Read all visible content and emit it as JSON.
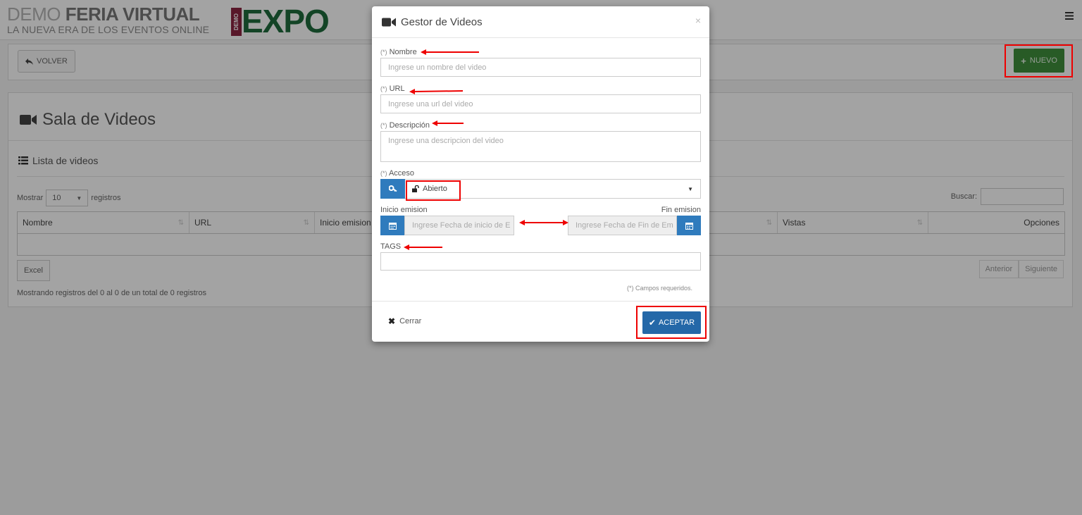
{
  "header": {
    "brand_demo": "DEMO",
    "brand_feria": "FERIA VIRTUAL",
    "brand_tagline": "LA NUEVA ERA DE LOS EVENTOS ONLINE",
    "expo_badge": "DEMO",
    "expo_text": "EXPO",
    "menu_icon": "hamburger-icon"
  },
  "toolbar": {
    "back_label": "VOLVER",
    "new_label": "NUEVO"
  },
  "page": {
    "title": "Sala de Videos",
    "list_title": "Lista de videos",
    "show_label": "Mostrar",
    "show_value": "10",
    "records_label": "registros",
    "search_label": "Buscar:",
    "excel_label": "Excel",
    "prev_label": "Anterior",
    "next_label": "Siguiente",
    "info_text": "Mostrando registros del 0 al 0 de un total de 0 registros"
  },
  "table": {
    "columns": [
      "Nombre",
      "URL",
      "Inicio emision",
      "Vistas",
      "Opciones"
    ]
  },
  "modal": {
    "title": "Gestor de Videos",
    "close_x": "×",
    "req_mark": "(*)",
    "nombre_label": "Nombre",
    "nombre_placeholder": "Ingrese un nombre del video",
    "url_label": "URL",
    "url_placeholder": "Ingrese una url del video",
    "descripcion_label": "Descripción",
    "descripcion_placeholder": "Ingrese una descripcion del video",
    "acceso_label": "Acceso",
    "acceso_value": "Abierto",
    "inicio_label": "Inicio emision",
    "fin_label": "Fin emision",
    "inicio_placeholder": "Ingrese Fecha de inicio de E",
    "fin_placeholder": "Ingrese Fecha de Fin de Em",
    "tags_label": "TAGS",
    "required_note": "(*) Campos requeridos.",
    "close_label": "Cerrar",
    "accept_label": "ACEPTAR"
  },
  "colors": {
    "primary": "#2f7bbd",
    "accept": "#2468a8",
    "success": "#3f8f3c",
    "annotation": "#e00000"
  }
}
